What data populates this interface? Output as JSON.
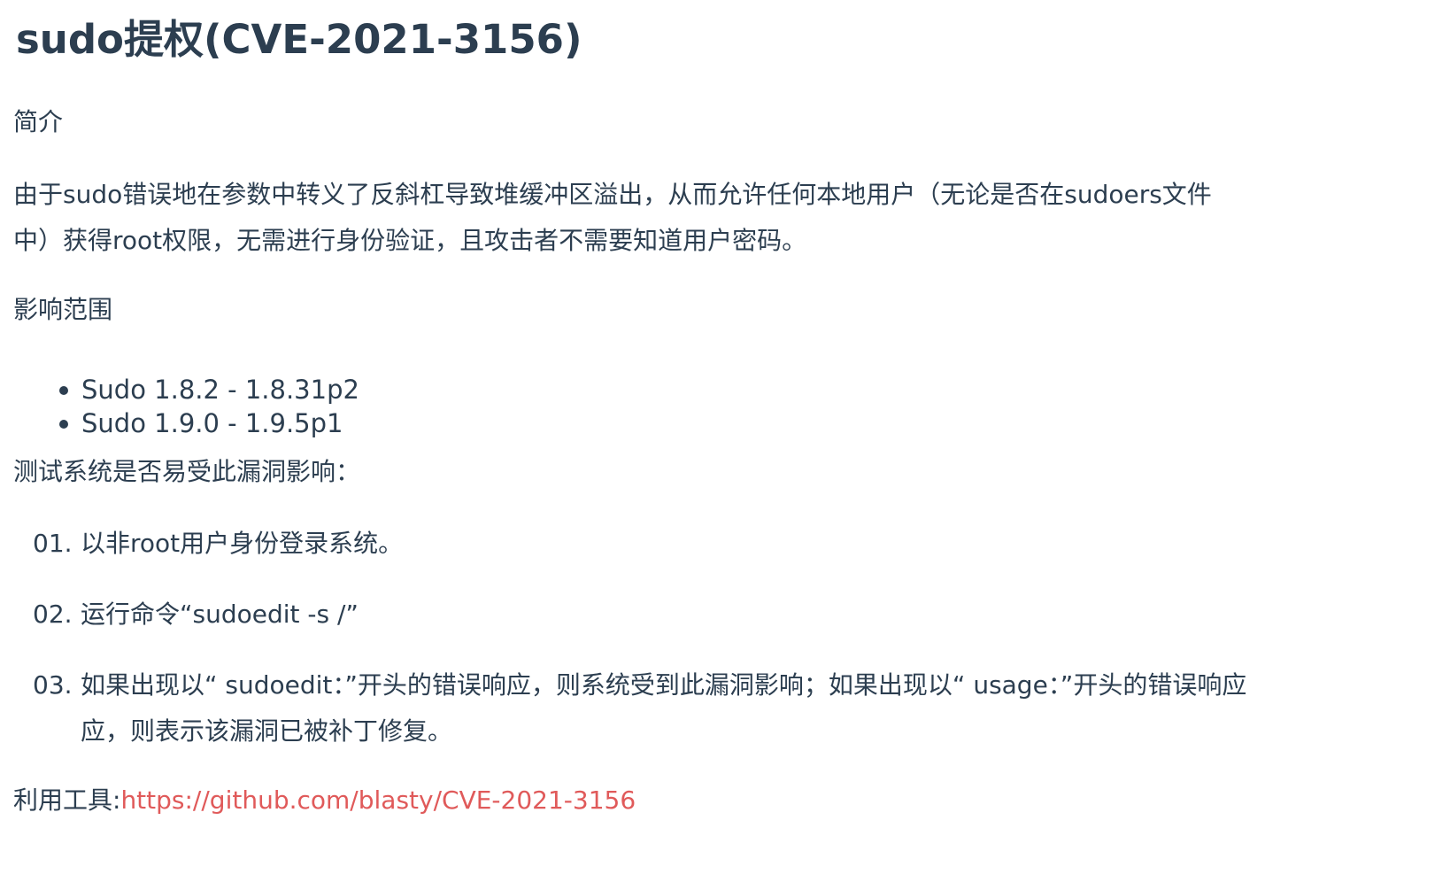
{
  "title": "sudo提权(CVE-2021-3156)",
  "intro_heading": "简介",
  "intro_lines": [
    "由于sudo错误地在参数中转义了反斜杠导致堆缓冲区溢出，从而允许任何本地用户（无论是否在sudoers文件",
    "中）获得root权限，无需进行身份验证，且攻击者不需要知道用户密码。"
  ],
  "scope_heading": "影响范围",
  "affected_versions": [
    "Sudo 1.8.2 - 1.8.31p2",
    "Sudo 1.9.0 - 1.9.5p1"
  ],
  "test_heading": "测试系统是否易受此漏洞影响：",
  "steps": [
    {
      "num": "01.",
      "lines": [
        "以非root用户身份登录系统。"
      ]
    },
    {
      "num": "02.",
      "lines": [
        "运行命令“sudoedit -s /”"
      ]
    },
    {
      "num": "03.",
      "lines": [
        "如果出现以“ sudoedit：”开头的错误响应，则系统受到此漏洞影响；如果出现以“ usage：”开头的错误响应",
        "应，则表示该漏洞已被补丁修复。"
      ]
    }
  ],
  "tool_label": "利用工具:",
  "tool_link": "https://github.com/blasty/CVE-2021-3156"
}
